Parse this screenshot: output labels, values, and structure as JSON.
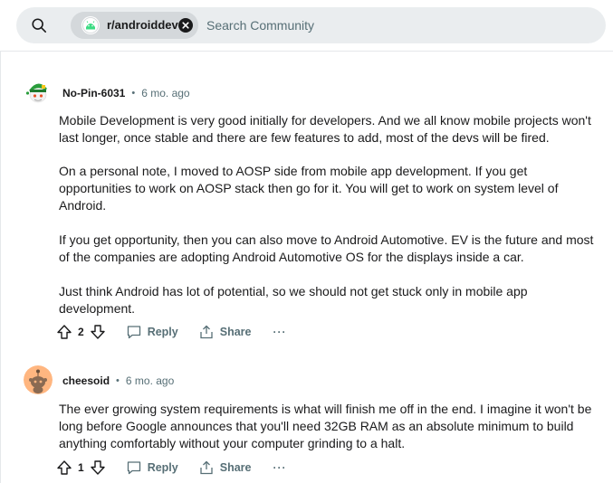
{
  "search": {
    "icon": "search-icon",
    "community_chip": "r/androiddev",
    "chip_icon": "android-community-icon",
    "clear_icon": "close-circle-icon",
    "placeholder": "Search Community"
  },
  "comments": [
    {
      "author": "No-Pin-6031",
      "separator": "•",
      "time": "6 mo. ago",
      "avatar_icon": "snoo-avatar-green-hat",
      "paragraphs": [
        "Mobile Development is very good initially for developers. And we all know mobile projects won't last longer, once stable and there are few features to add, most of the devs will be fired.",
        "On a personal note, I moved to AOSP side from mobile app development. If you get opportunities to work on AOSP stack then go for it. You will get to work on system level of Android.",
        "If you get opportunity, then you can also move to Android Automotive. EV is the future and most of the companies are adopting Android Automotive OS for the displays inside a car.",
        "Just think Android has lot of potential, so we should not get stuck only in mobile app development."
      ],
      "votes": "2",
      "reply_label": "Reply",
      "share_label": "Share",
      "more_label": "···"
    },
    {
      "author": "cheesoid",
      "separator": "•",
      "time": "6 mo. ago",
      "avatar_icon": "snoo-avatar-orange",
      "paragraphs": [
        "The ever growing system requirements is what will finish me off in the end. I imagine it won't be long before Google announces that you'll need 32GB RAM as an absolute minimum to build anything comfortably without your computer grinding to a halt."
      ],
      "votes": "1",
      "reply_label": "Reply",
      "share_label": "Share",
      "more_label": "···"
    }
  ],
  "colors": {
    "search_bg": "#eaedef",
    "chip_bg": "#d4d8db",
    "meta_text": "#576f76",
    "body_text": "#1a1a1b",
    "avatar1_bg": "#ffffff",
    "avatar2_bg": "#ffb680"
  }
}
